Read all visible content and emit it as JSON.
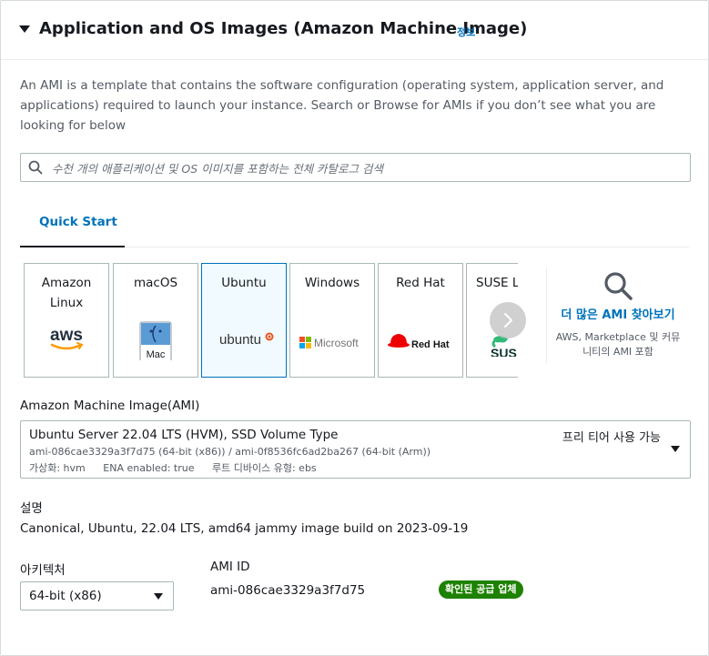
{
  "section": {
    "title": "Application and OS Images (Amazon Machine Image)",
    "info_label": "정보",
    "description": "An AMI is a template that contains the software configuration (operating system, application server, and applications) required to launch your instance. Search or Browse for AMIs if you don’t see what you are looking for below"
  },
  "search": {
    "placeholder": "수천 개의 애플리케이션 및 OS 이미지를 포함하는 전체 카탈로그 검색",
    "value": ""
  },
  "tabs": [
    {
      "label": "Quick Start",
      "active": true
    }
  ],
  "os_tiles": [
    {
      "name": "Amazon Linux",
      "logo": "aws-logo",
      "logo_text": "aws"
    },
    {
      "name": "macOS",
      "logo": "mac-logo",
      "logo_text": "Mac"
    },
    {
      "name": "Ubuntu",
      "logo": "ubuntu-logo",
      "logo_text": "ubuntu",
      "selected": true
    },
    {
      "name": "Windows",
      "logo": "microsoft-logo",
      "logo_text": "Microsoft"
    },
    {
      "name": "Red Hat",
      "logo": "redhat-logo",
      "logo_text": "Red Hat"
    },
    {
      "name": "SUSE Li",
      "logo": "suse-logo",
      "logo_text": "SUS"
    }
  ],
  "browse": {
    "link": "더 많은 AMI 찾아보기",
    "subtext": "AWS, Marketplace 및 커뮤니티의 AMI 포함"
  },
  "ami": {
    "label": "Amazon Machine Image(AMI)",
    "name": "Ubuntu Server 22.04 LTS (HVM), SSD Volume Type",
    "ids": "ami-086cae3329a3f7d75 (64-bit (x86)) / ami-0f8536fc6ad2ba267 (64-bit (Arm))",
    "virtualization": "가상화: hvm",
    "ena": "ENA enabled: true",
    "root_device": "루트 디바이스 유형: ebs",
    "free_tier": "프리 티어 사용 가능"
  },
  "details": {
    "description_label": "설명",
    "description_text": "Canonical, Ubuntu, 22.04 LTS, amd64 jammy image build on 2023-09-19",
    "arch_label": "아키텍처",
    "arch_value": "64-bit (x86)",
    "ami_id_label": "AMI ID",
    "ami_id_value": "ami-086cae3329a3f7d75",
    "verified_badge": "확인된 공급 업체"
  },
  "colors": {
    "link": "#0073bb",
    "badge_green": "#1d8102",
    "aws_orange": "#ff9900",
    "ubuntu_orange": "#e95420",
    "redhat_red": "#ee0000",
    "suse_green": "#30ba78"
  }
}
